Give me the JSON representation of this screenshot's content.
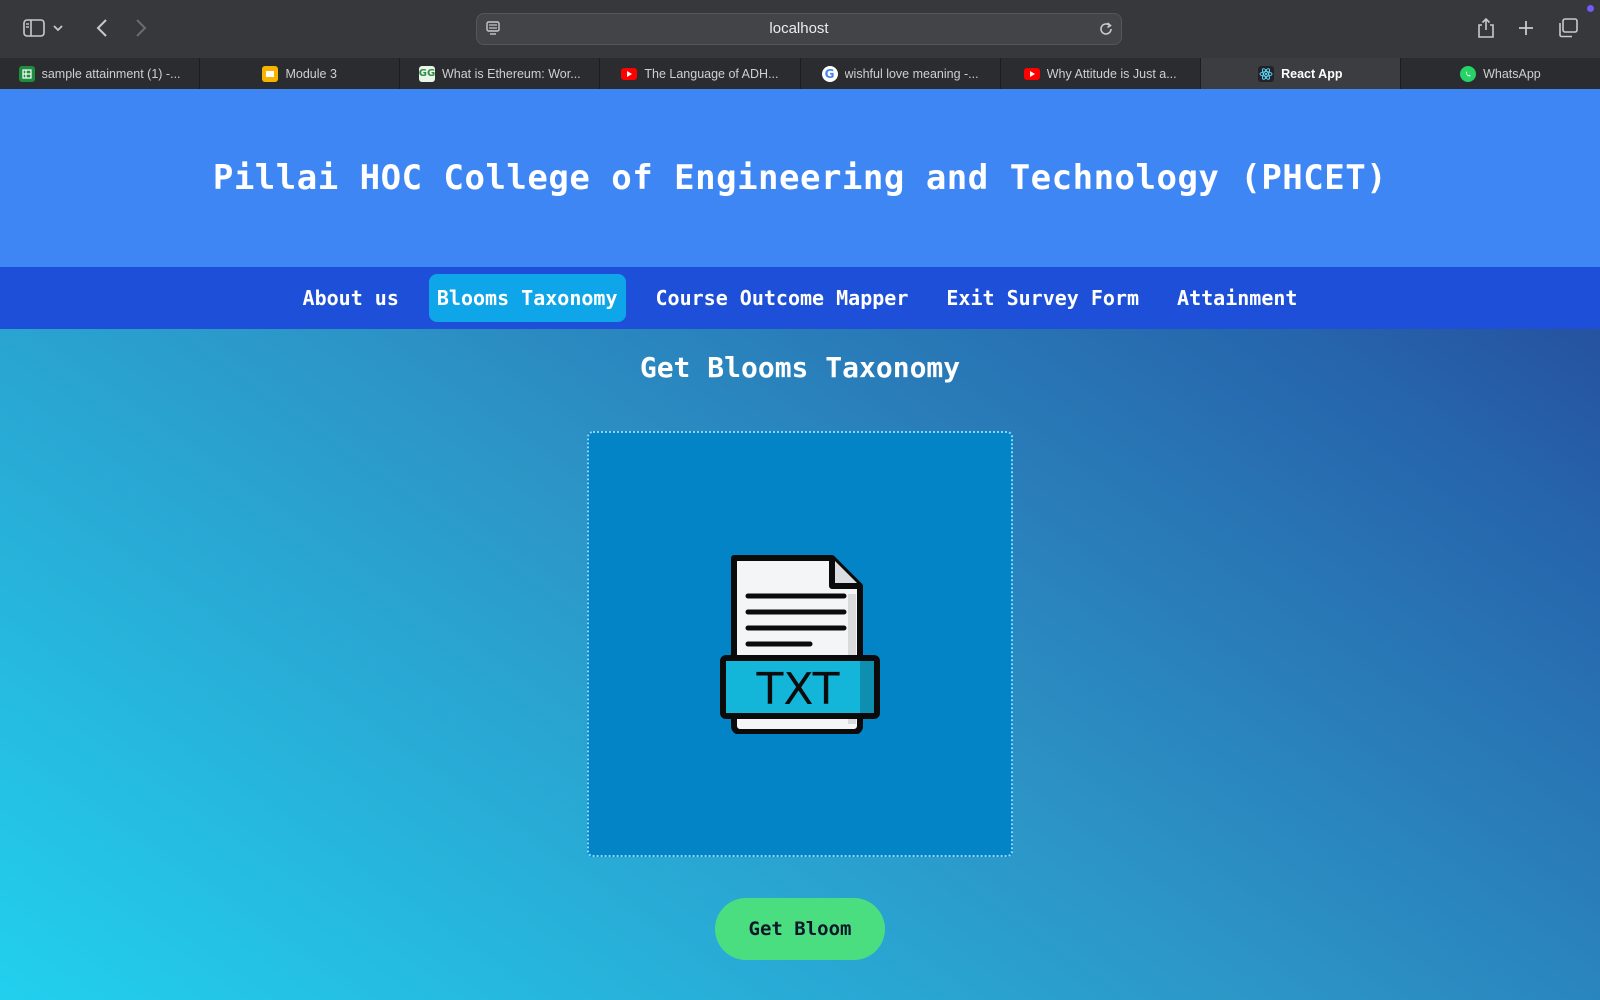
{
  "browser": {
    "url": "localhost",
    "tabs": [
      {
        "label": "sample attainment (1) -...",
        "icon": "google-sheets-icon",
        "color": "#1e8e3e"
      },
      {
        "label": "Module 3",
        "icon": "google-slides-icon",
        "color": "#f4b400"
      },
      {
        "label": "What is Ethereum: Wor...",
        "icon": "geeksforgeeks-icon",
        "color": "#2f8d46"
      },
      {
        "label": "The Language of ADH...",
        "icon": "youtube-icon",
        "color": "#ff0000"
      },
      {
        "label": "wishful love meaning -...",
        "icon": "google-icon",
        "color": "#4285f4"
      },
      {
        "label": "Why Attitude is Just a...",
        "icon": "youtube-icon",
        "color": "#ff0000"
      },
      {
        "label": "React App",
        "icon": "react-icon",
        "color": "#61dafb",
        "active": true
      },
      {
        "label": "WhatsApp",
        "icon": "whatsapp-icon",
        "color": "#25d366"
      }
    ]
  },
  "site": {
    "title": "Pillai HOC College of Engineering and Technology (PHCET)",
    "nav": [
      {
        "label": "About us"
      },
      {
        "label": "Blooms Taxonomy",
        "active": true
      },
      {
        "label": "Course Outcome Mapper"
      },
      {
        "label": "Exit Survey Form"
      },
      {
        "label": "Attainment"
      }
    ]
  },
  "main": {
    "heading": "Get Blooms Taxonomy",
    "dropzone_icon": "txt-file-icon",
    "file_badge": "TXT",
    "button_label": "Get Bloom"
  },
  "colors": {
    "header_bg": "#3f86f5",
    "nav_bg": "#1d4fd8",
    "nav_active": "#0ea5e9",
    "dropzone_bg": "#0284c7",
    "button_bg": "#4ade80"
  }
}
